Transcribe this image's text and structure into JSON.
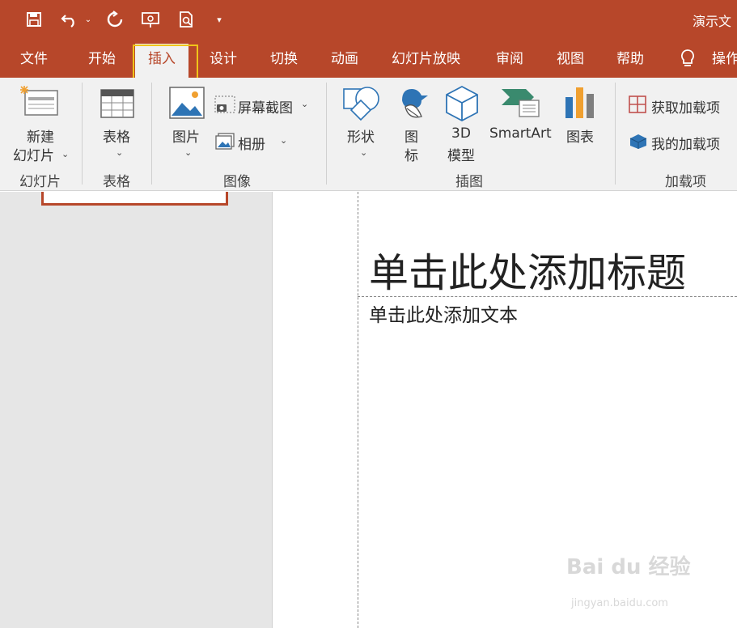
{
  "title_bar": {
    "doc_title": "演示文"
  },
  "tabs": [
    {
      "label": "文件"
    },
    {
      "label": "开始"
    },
    {
      "label": "插入",
      "active": true
    },
    {
      "label": "设计"
    },
    {
      "label": "切换"
    },
    {
      "label": "动画"
    },
    {
      "label": "幻灯片放映"
    },
    {
      "label": "审阅"
    },
    {
      "label": "视图"
    },
    {
      "label": "帮助"
    },
    {
      "label": "操作"
    }
  ],
  "ribbon": {
    "slides": {
      "new_slide_line1": "新建",
      "new_slide_line2": "幻灯片",
      "group": "幻灯片"
    },
    "tables": {
      "table_label": "表格",
      "group": "表格"
    },
    "images": {
      "picture_label": "图片",
      "screenshot_label": "屏幕截图",
      "album_label": "相册",
      "group": "图像"
    },
    "illustrations": {
      "shapes_label": "形状",
      "icons_line1": "图",
      "icons_line2": "标",
      "model_line1": "3D",
      "model_line2": "模型",
      "smartart_label": "SmartArt",
      "chart_label": "图表",
      "group": "插图"
    },
    "addins": {
      "get_addins_label": "获取加载项",
      "my_addins_label": "我的加载项",
      "group": "加载项"
    }
  },
  "slide": {
    "title_placeholder": "单击此处添加标题",
    "text_placeholder": "单击此处添加文本"
  },
  "watermark": {
    "main": "Bai du 经验",
    "sub": "jingyan.baidu.com"
  },
  "colors": {
    "accent": "#b7472a",
    "highlight": "#f0c419",
    "ribbon_bg": "#f1f1f1"
  }
}
